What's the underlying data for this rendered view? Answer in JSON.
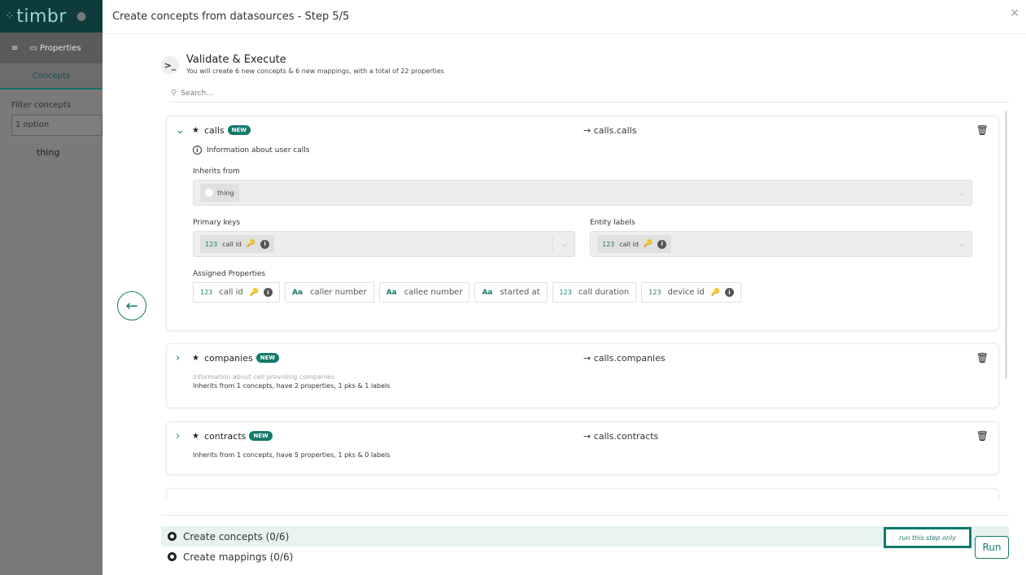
{
  "background_app": {
    "logo": "timbr",
    "toolbar_label": "Properties",
    "tab": "Concepts",
    "filter_label": "Filter concepts",
    "filter_value": "1 option",
    "items": [
      "thing"
    ]
  },
  "modal": {
    "title": "Create concepts from datasources - Step 5/5",
    "close": "×",
    "back": "←"
  },
  "step": {
    "title": "Validate & Execute",
    "subtitle": "You will create 6 new concepts & 6 new mappings, with a total of 22 properties",
    "search_placeholder": "Search..."
  },
  "concepts": [
    {
      "name": "calls",
      "badge": "NEW",
      "mapping": "→ calls.calls",
      "description": "Information about user calls",
      "inherits_label": "Inherits from",
      "inherits": [
        "thing"
      ],
      "primary_keys_label": "Primary keys",
      "primary_keys": [
        {
          "type": "123",
          "name": "call id"
        }
      ],
      "entity_labels_label": "Entity labels",
      "entity_labels": [
        {
          "type": "123",
          "name": "call id"
        }
      ],
      "assigned_label": "Assigned Properties",
      "properties": [
        {
          "type": "123",
          "name": "call id",
          "key": true
        },
        {
          "type": "Aa",
          "name": "caller number",
          "key": false
        },
        {
          "type": "Aa",
          "name": "callee number",
          "key": false
        },
        {
          "type": "Aa",
          "name": "started at",
          "key": false
        },
        {
          "type": "123",
          "name": "call duration",
          "key": false
        },
        {
          "type": "123",
          "name": "device id",
          "key": true
        }
      ]
    },
    {
      "name": "companies",
      "badge": "NEW",
      "mapping": "→ calls.companies",
      "description": "Information about cell providing companies",
      "summary": "Inherits from 1 concepts, have 2 properties, 1 pks & 1 labels"
    },
    {
      "name": "contracts",
      "badge": "NEW",
      "mapping": "→ calls.contracts",
      "summary": "Inherits from 1 concepts, have 5 properties, 1 pks & 0 labels"
    }
  ],
  "steps": [
    {
      "label": "Create concepts (0/6)",
      "active": true
    },
    {
      "label": "Create mappings (0/6)",
      "active": false
    }
  ],
  "run_only_label": "run this step only",
  "run_label": "Run",
  "colors": {
    "accent": "#137a6c",
    "header_dark": "#0e3b3b"
  }
}
